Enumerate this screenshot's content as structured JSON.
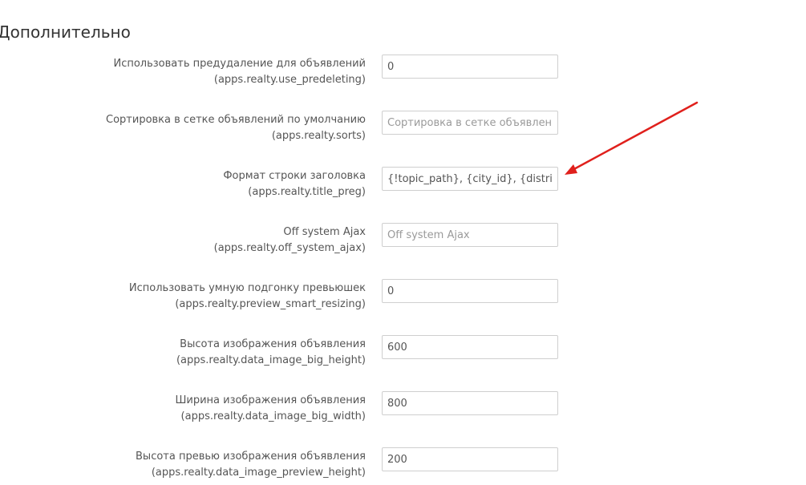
{
  "section": {
    "title": "Дополнительно"
  },
  "fields": [
    {
      "label": "Использовать предудаление для объявлений",
      "key": "(apps.realty.use_predeleting)",
      "value": "0",
      "placeholder": ""
    },
    {
      "label": "Сортировка в сетке объявлений по умолчанию",
      "key": "(apps.realty.sorts)",
      "value": "",
      "placeholder": "Сортировка в сетке объявлений"
    },
    {
      "label": "Формат строки заголовка",
      "key": "(apps.realty.title_preg)",
      "value": "{!topic_path}, {city_id}, {district_id}",
      "placeholder": ""
    },
    {
      "label": "Off system Ajax",
      "key": "(apps.realty.off_system_ajax)",
      "value": "",
      "placeholder": "Off system Ajax"
    },
    {
      "label": "Использовать умную подгонку превьюшек",
      "key": "(apps.realty.preview_smart_resizing)",
      "value": "0",
      "placeholder": ""
    },
    {
      "label": "Высота изображения объявления",
      "key": "(apps.realty.data_image_big_height)",
      "value": "600",
      "placeholder": ""
    },
    {
      "label": "Ширина изображения объявления",
      "key": "(apps.realty.data_image_big_width)",
      "value": "800",
      "placeholder": ""
    },
    {
      "label": "Высота превью изображения объявления",
      "key": "(apps.realty.data_image_preview_height)",
      "value": "200",
      "placeholder": ""
    }
  ],
  "annotation": {
    "arrow_color": "#e0201c"
  }
}
